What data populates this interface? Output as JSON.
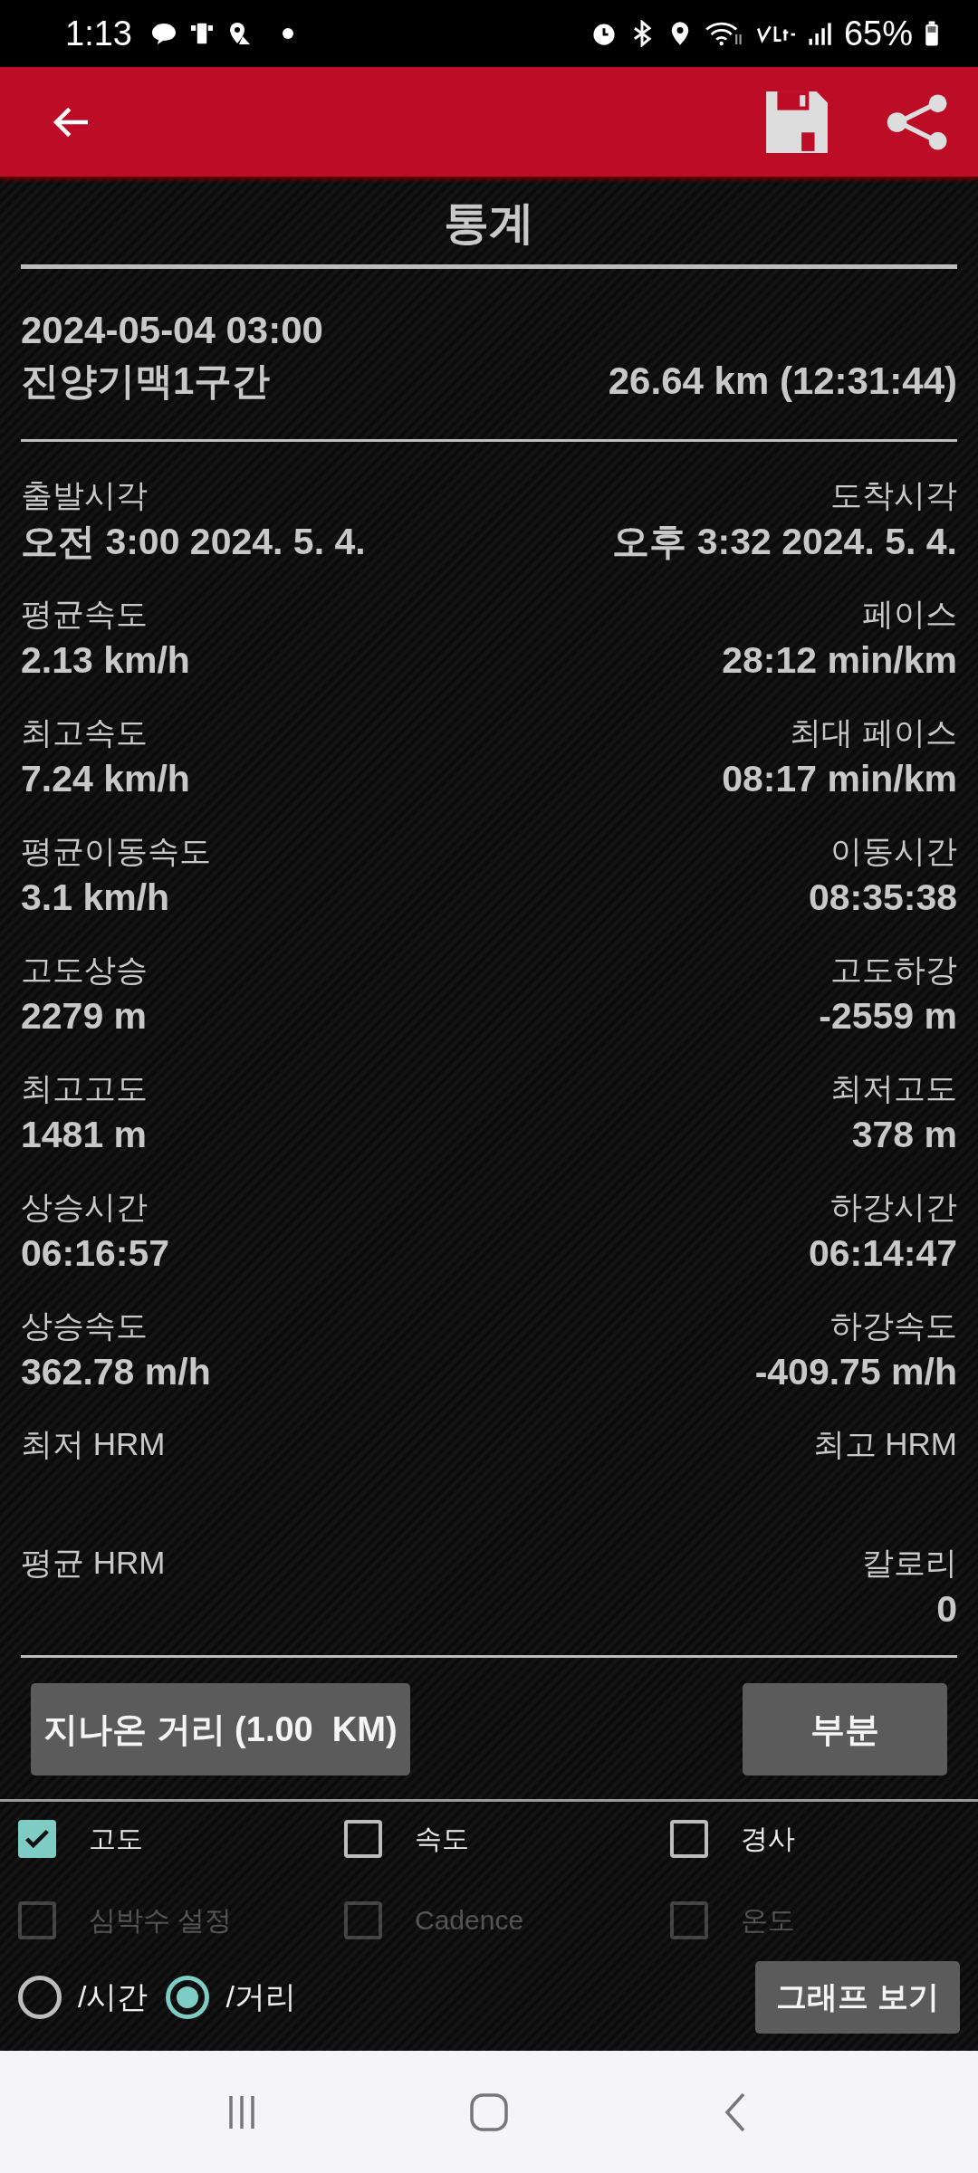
{
  "status_bar": {
    "time": "1:13",
    "battery": "65%"
  },
  "title": "통계",
  "track": {
    "date": "2024-05-04 03:00",
    "name": "진양기맥1구간",
    "summary": "26.64 km (12:31:44)"
  },
  "stats": [
    {
      "left": {
        "label": "출발시각",
        "value": "오전 3:00 2024. 5. 4."
      },
      "right": {
        "label": "도착시각",
        "value": "오후 3:32 2024. 5. 4."
      }
    },
    {
      "left": {
        "label": "평균속도",
        "value": "2.13 km/h"
      },
      "right": {
        "label": "페이스",
        "value": "28:12 min/km"
      }
    },
    {
      "left": {
        "label": "최고속도",
        "value": "7.24 km/h"
      },
      "right": {
        "label": "최대 페이스",
        "value": "08:17 min/km"
      }
    },
    {
      "left": {
        "label": "평균이동속도",
        "value": "3.1 km/h"
      },
      "right": {
        "label": "이동시간",
        "value": "08:35:38"
      }
    },
    {
      "left": {
        "label": "고도상승",
        "value": "2279 m"
      },
      "right": {
        "label": "고도하강",
        "value": "-2559 m"
      }
    },
    {
      "left": {
        "label": "최고고도",
        "value": "1481 m"
      },
      "right": {
        "label": "최저고도",
        "value": "378 m"
      }
    },
    {
      "left": {
        "label": "상승시간",
        "value": "06:16:57"
      },
      "right": {
        "label": "하강시간",
        "value": "06:14:47"
      }
    },
    {
      "left": {
        "label": "상승속도",
        "value": "362.78 m/h"
      },
      "right": {
        "label": "하강속도",
        "value": "-409.75 m/h"
      }
    },
    {
      "left": {
        "label": "최저 HRM"
      },
      "right": {
        "label": "최고 HRM"
      }
    },
    {
      "left": {
        "label": "평균 HRM"
      },
      "right": {
        "label": "칼로리",
        "value": "0"
      }
    }
  ],
  "distance_button": "지나온 거리 (1.00  KM)",
  "segment_button": "부분",
  "graph_options": [
    {
      "label": "고도",
      "checked": true,
      "disabled": false
    },
    {
      "label": "속도",
      "checked": false,
      "disabled": false
    },
    {
      "label": "경사",
      "checked": false,
      "disabled": false
    },
    {
      "label": "심박수 설정",
      "checked": false,
      "disabled": true
    },
    {
      "label": "Cadence",
      "checked": false,
      "disabled": true
    },
    {
      "label": "온도",
      "checked": false,
      "disabled": true
    }
  ],
  "axis_options": [
    {
      "label": "/시간",
      "selected": false
    },
    {
      "label": "/거리",
      "selected": true
    }
  ],
  "graph_button": "그래프 보기"
}
